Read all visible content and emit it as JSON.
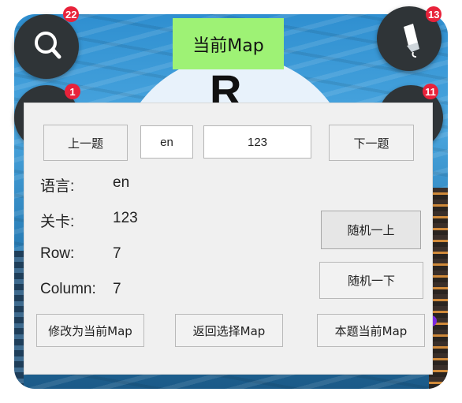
{
  "top_tab": {
    "label": "当前Map"
  },
  "corner_buttons": {
    "search": {
      "icon": "magnifier-icon",
      "badge": "22"
    },
    "paint": {
      "icon": "paint-brush-icon",
      "badge": "13"
    },
    "left_mid": {
      "badge": "1"
    },
    "right_mid": {
      "badge": "11"
    }
  },
  "background": {
    "big_letter": "R"
  },
  "dialog": {
    "prev_button": "上一题",
    "language_field": "en",
    "level_field": "123",
    "next_button": "下一题",
    "info": {
      "language": {
        "label": "语言:",
        "value": "en"
      },
      "level": {
        "label": "关卡:",
        "value": "123"
      },
      "row": {
        "label": "Row:",
        "value": "7"
      },
      "column": {
        "label": "Column:",
        "value": "7"
      }
    },
    "random_up_button": "随机一上",
    "random_down_button": "随机一下",
    "modify_button": "修改为当前Map",
    "back_button": "返回选择Map",
    "current_button": "本题当前Map"
  },
  "colors": {
    "tab_bg": "#9ef275",
    "badge": "#e8223a",
    "dialog_bg": "#f0f0f0"
  }
}
